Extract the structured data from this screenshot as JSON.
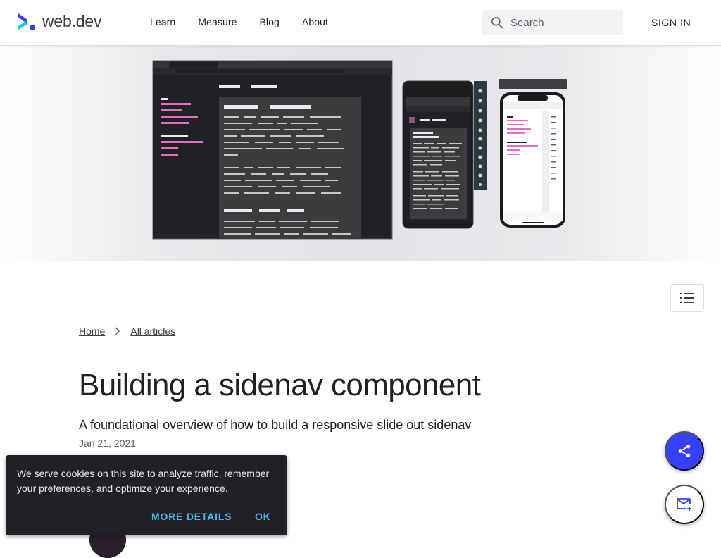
{
  "header": {
    "logo_text": "web.dev",
    "nav": [
      {
        "label": "Learn"
      },
      {
        "label": "Measure"
      },
      {
        "label": "Blog"
      },
      {
        "label": "About"
      }
    ],
    "search_placeholder": "Search",
    "sign_in": "SIGN IN"
  },
  "colors": {
    "brand_blue": "#3740ff",
    "logo_cyan": "#00c9db",
    "accent_pink": "#e070c0",
    "cookie_link": "#4fb6e9"
  },
  "hero": {
    "image": "sidenav-devices-screenshot"
  },
  "breadcrumb": {
    "home": "Home",
    "articles": "All articles"
  },
  "article": {
    "title": "Building a sidenav component",
    "subtitle": "A foundational overview of how to build a responsive slide out sidenav",
    "date": "Jan 21, 2021"
  },
  "cookie_banner": {
    "message": "We serve cookies on this site to analyze traffic, remember your preferences, and optimize your experience.",
    "more_details": "MORE DETAILS",
    "ok": "OK"
  },
  "icons": {
    "toc": "list-icon",
    "share": "share-icon",
    "subscribe": "mail-add-icon",
    "search": "search-icon"
  }
}
